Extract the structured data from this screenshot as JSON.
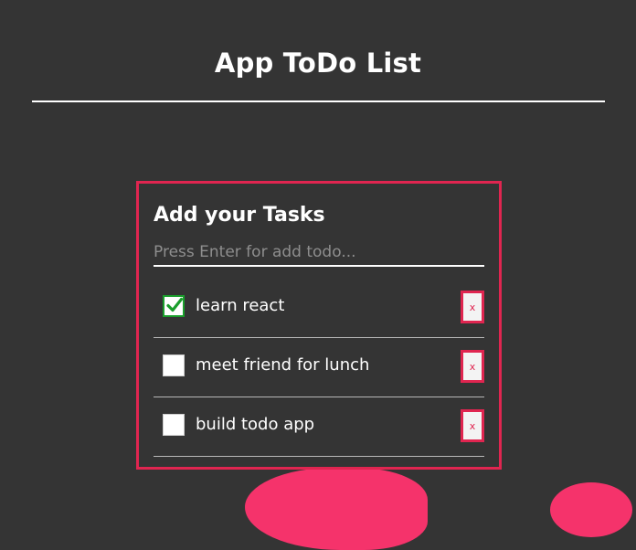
{
  "header": {
    "title": "App ToDo List"
  },
  "card": {
    "heading": "Add your Tasks",
    "input": {
      "placeholder": "Press Enter for add todo...",
      "value": ""
    }
  },
  "todos": [
    {
      "text": "learn react",
      "completed": true,
      "delete_label": "x"
    },
    {
      "text": "meet friend for lunch",
      "completed": false,
      "delete_label": "x"
    },
    {
      "text": "build todo app",
      "completed": false,
      "delete_label": "x"
    }
  ],
  "colors": {
    "background": "#343434",
    "accent": "#e02550",
    "blob": "#f5336b",
    "check": "#1a9e2c"
  }
}
